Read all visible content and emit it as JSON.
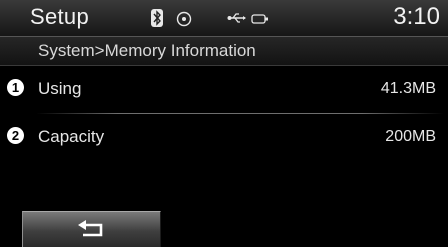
{
  "status_bar": {
    "title": "Setup",
    "time": "3:10",
    "icons": [
      "bluetooth-icon",
      "disc-icon",
      "usb-icon",
      "ipod-icon"
    ]
  },
  "breadcrumb": "System>Memory Information",
  "items": [
    {
      "number": "1",
      "label": "Using",
      "value": "41.3MB"
    },
    {
      "number": "2",
      "label": "Capacity",
      "value": "200MB"
    }
  ],
  "bottom_bar": {
    "back_icon": "return-arrow-icon"
  }
}
